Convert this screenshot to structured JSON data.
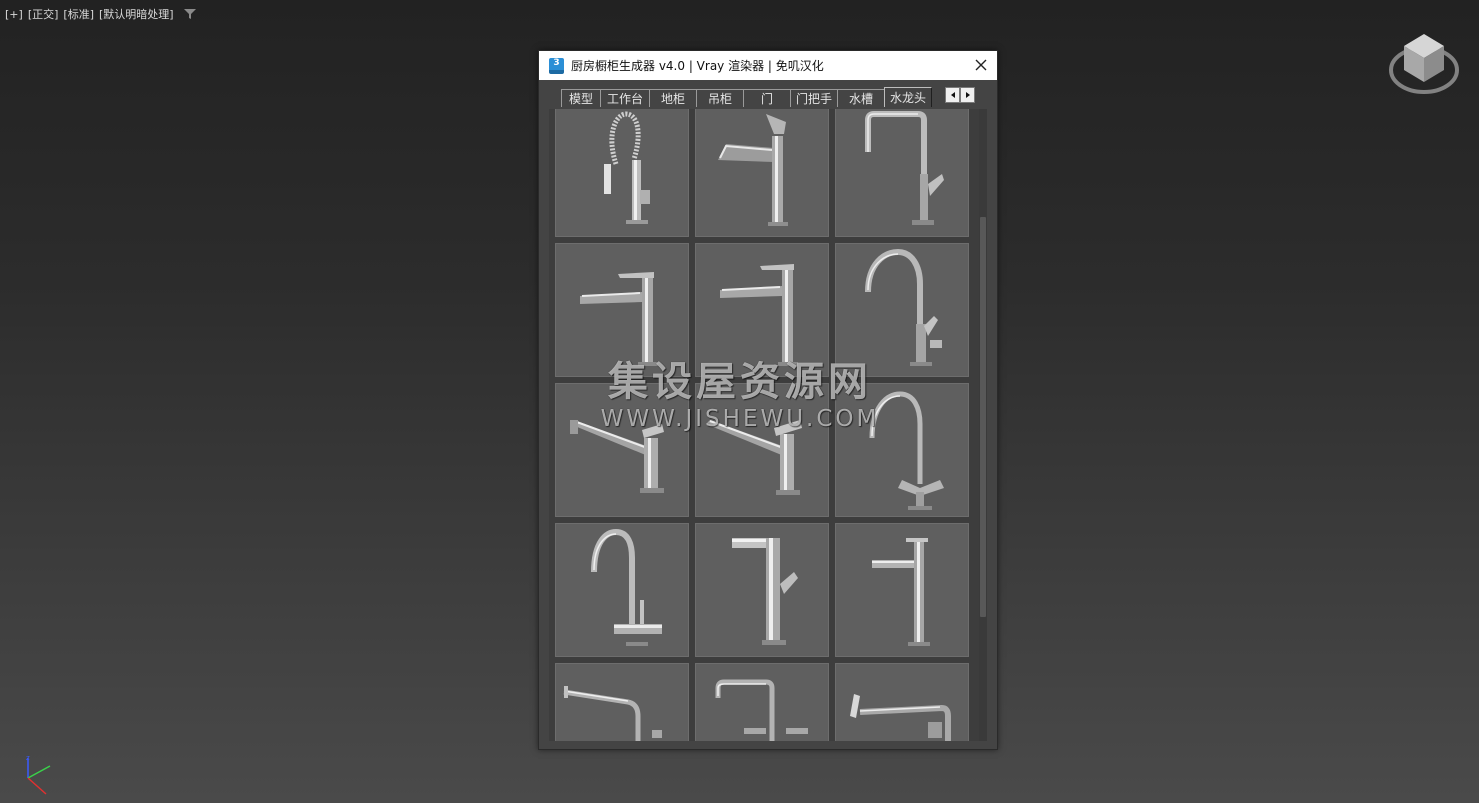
{
  "viewport": {
    "labels": [
      "[+]",
      "[正交]",
      "[标准]",
      "[默认明暗处理]"
    ],
    "filter_icon": "funnel-icon"
  },
  "dialog": {
    "title": "厨房橱柜生成器 v4.0 | Vray 渲染器 | 免叽汉化",
    "app_icon_text": "3",
    "tabs": [
      {
        "label": "模型"
      },
      {
        "label": "工作台"
      },
      {
        "label": "地柜"
      },
      {
        "label": "吊柜"
      },
      {
        "label": "门"
      },
      {
        "label": "门把手"
      },
      {
        "label": "水槽"
      },
      {
        "label": "水龙头"
      }
    ],
    "active_tab": "水龙头",
    "faucet_count_visible": 15
  },
  "watermark": {
    "line1": "集设屋资源网",
    "line2": "WWW.JISHEWU.COM"
  },
  "colors": {
    "dialog_bg": "#444444",
    "thumb_bg": "#5f5f5f",
    "chrome": "#d0d0d0"
  }
}
